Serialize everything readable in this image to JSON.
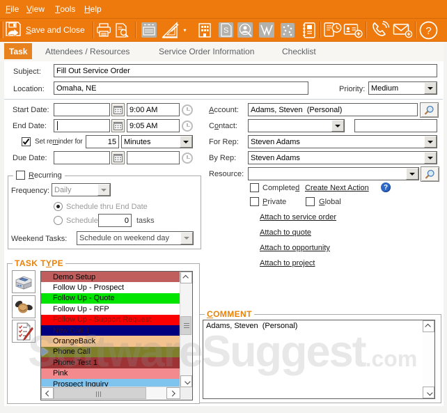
{
  "colors": {
    "orange": "#EE7A0D",
    "orange_dark": "#D4690A",
    "tab_active_bg": "#E8821E",
    "group_title_orange": "#E8820A",
    "help_icon_blue": "#2D68C8",
    "pointer_blue": "#7A99B8"
  },
  "menubar": {
    "items": [
      {
        "t": "File",
        "u": 0
      },
      {
        "t": "View",
        "u": 0
      },
      {
        "t": "Tools",
        "u": 0
      },
      {
        "t": "Help",
        "u": 0
      }
    ]
  },
  "toolbar": {
    "save_button": {
      "t": "Save and Close",
      "u": 0
    },
    "icons": [
      "save",
      "print",
      "print-preview",
      "cash-register",
      "set-square",
      "dropdown-arrow",
      "company-building",
      "quote-document",
      "contact-search",
      "activity-chart",
      "opportunity-dots",
      "notebook",
      "journal-clock",
      "new-contact-card",
      "phone",
      "send-email",
      "help"
    ]
  },
  "tabs": {
    "items": [
      {
        "t": "Task",
        "active": true
      },
      {
        "t": "Attendees / Resources",
        "active": false
      },
      {
        "t": "Service Order Information",
        "active": false
      },
      {
        "t": "Checklist",
        "active": false
      }
    ]
  },
  "form": {
    "subject": {
      "label": "Subject:",
      "value": "Fill Out Service Order"
    },
    "location": {
      "label": "Location:",
      "value": "Omaha, NE"
    },
    "priority": {
      "label": "Priority:",
      "value": "Medium"
    },
    "start_date": {
      "label": "Start Date:",
      "date": "",
      "time": "9:00 AM"
    },
    "end_date": {
      "label": "End Date:",
      "date": "",
      "time": "9:05 AM"
    },
    "reminder": {
      "label": {
        "t": "Set reminder for",
        "u": 6
      },
      "checked": true,
      "value": "15",
      "unit": "Minutes"
    },
    "due_date": {
      "label": "Due Date:",
      "date": "",
      "time": ""
    },
    "account": {
      "label": {
        "t": "Account:",
        "u": 0
      },
      "value": "Adams, Steven  (Personal)"
    },
    "contact": {
      "label": {
        "t": "Contact:",
        "u": 1
      },
      "dropdown_value": "",
      "value": ""
    },
    "for_rep": {
      "label": "For Rep:",
      "value": "Steven Adams"
    },
    "by_rep": {
      "label": "By Rep:",
      "value": "Steven Adams"
    },
    "resource": {
      "label": "Resource:",
      "value": ""
    },
    "completed": {
      "label": {
        "t": "Completed",
        "u": 8
      },
      "checked": false
    },
    "create_next_action": "Create Next Action",
    "private_cb": {
      "label": {
        "t": "Private",
        "u": 0
      },
      "checked": false
    },
    "global_cb": {
      "label": {
        "t": "Global",
        "u": 0
      },
      "checked": false
    },
    "attach_links": {
      "service_order": "Attach to service order",
      "quote": "Attach to quote",
      "opportunity": "Attach to opportunity",
      "project": "Attach to project"
    }
  },
  "recurring": {
    "title": {
      "t": "Recurring",
      "u": 0
    },
    "checked": false,
    "frequency": {
      "label": "Frequency:",
      "value": "Daily"
    },
    "schedule_thru": {
      "label": "Schedule thru End Date",
      "selected": true
    },
    "schedule_n": {
      "label": "Schedule",
      "value": "0",
      "suffix": "tasks",
      "selected": false
    },
    "weekend": {
      "label": "Weekend Tasks:",
      "value": "Schedule on weekend day"
    }
  },
  "task_type": {
    "title": {
      "t": "TASK TYPE",
      "u": 6
    },
    "items": [
      {
        "label": "Demo Setup",
        "bg": "#C05E5E",
        "fg": "#000000"
      },
      {
        "label": "Follow Up - Prospect",
        "bg": "#FFFFFF",
        "fg": "#000000"
      },
      {
        "label": "Follow Up - Quote",
        "bg": "#00E500",
        "fg": "#000000"
      },
      {
        "label": "Follow Up - RFP",
        "bg": "#FFFFFF",
        "fg": "#000000"
      },
      {
        "label": "Follow Up - Support Request",
        "bg": "#FA0000",
        "fg": "#7E1A10"
      },
      {
        "label": "New Call 1",
        "bg": "#00007E",
        "fg": "#2E0E30"
      },
      {
        "label": "OrangeBack",
        "bg": "#F2C38F",
        "fg": "#000000"
      },
      {
        "label": "Phone Call",
        "bg": "#7F7F2B",
        "fg": "#000000"
      },
      {
        "label": "Phone Test 1",
        "bg": "#9E3336",
        "fg": "#000000"
      },
      {
        "label": "Pink",
        "bg": "#F28A8E",
        "fg": "#000000"
      },
      {
        "label": "Prospect Inquiry",
        "bg": "#7FC3EF",
        "fg": "#000000"
      }
    ],
    "side_buttons": [
      "fax-machine",
      "handshake",
      "checklist-pen"
    ]
  },
  "comment": {
    "title": {
      "t": "COMMENT",
      "u": 0
    },
    "text": "Adams, Steven  (Personal)"
  },
  "watermark": {
    "main": "SoftwareSuggest",
    "suffix": ".com"
  }
}
